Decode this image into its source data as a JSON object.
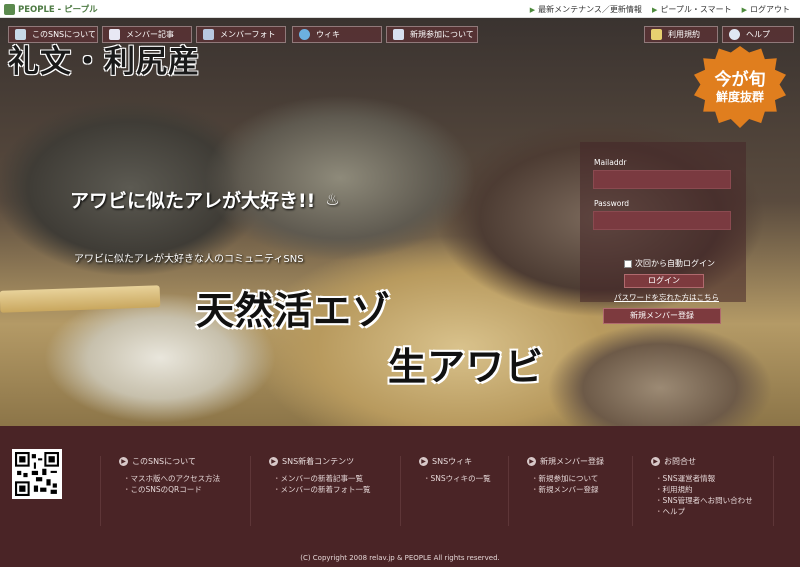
{
  "brand": {
    "name": "PEOPLE - ピープル"
  },
  "top_links": [
    "最新メンテナンス／更新情報",
    "ピープル・スマート",
    "ログアウト"
  ],
  "nav_left": [
    "このSNSについて",
    "メンバー記事",
    "メンバーフォト",
    "ウィキ",
    "新規参加について"
  ],
  "nav_right": [
    "利用規約",
    "ヘルプ"
  ],
  "hero": {
    "title": "礼文・利尻産",
    "seal_line1": "今が旬",
    "seal_line2": "鮮度抜群",
    "catch": "アワビに似たアレが大好き!!",
    "sub": "アワビに似たアレが大好きな人のコミュニティSNS",
    "big1": "天然活エゾ",
    "big2": "生アワビ"
  },
  "login": {
    "mail_label": "Mailaddr",
    "password_label": "Password",
    "auto_login": "次回から自動ログイン",
    "login_button": "ログイン",
    "forgot": "パスワードを忘れた方はこちら",
    "signup_button": "新規メンバー登録"
  },
  "footer": {
    "columns": [
      {
        "title": "このSNSについて",
        "links": [
          "マスホ版へのアクセス方法",
          "このSNSのQRコード"
        ]
      },
      {
        "title": "SNS新着コンテンツ",
        "links": [
          "メンバーの新着記事一覧",
          "メンバーの新着フォト一覧"
        ]
      },
      {
        "title": "SNSウィキ",
        "links": [
          "SNSウィキの一覧"
        ]
      },
      {
        "title": "新規メンバー登録",
        "links": [
          "新規参加について",
          "新規メンバー登録"
        ]
      },
      {
        "title": "お問合せ",
        "links": [
          "SNS運営者情報",
          "利用規約",
          "SNS管理者へお問い合わせ",
          "ヘルプ"
        ]
      }
    ],
    "copyright": "(C) Copyright 2008 relav.jp & PEOPLE All rights reserved."
  },
  "icons": {
    "nav_about": "person-icon",
    "nav_articles": "document-icon",
    "nav_photos": "photo-icon",
    "nav_wiki": "globe-icon",
    "nav_join": "people-icon",
    "nav_terms": "pen-icon",
    "nav_help": "help-icon",
    "hero_catch": "hot-spring-icon"
  },
  "colors": {
    "accent": "#7d3a3e",
    "footer_bg": "#4a2426",
    "brand_green": "#4d7a43",
    "seal_orange": "#e07e1e"
  }
}
